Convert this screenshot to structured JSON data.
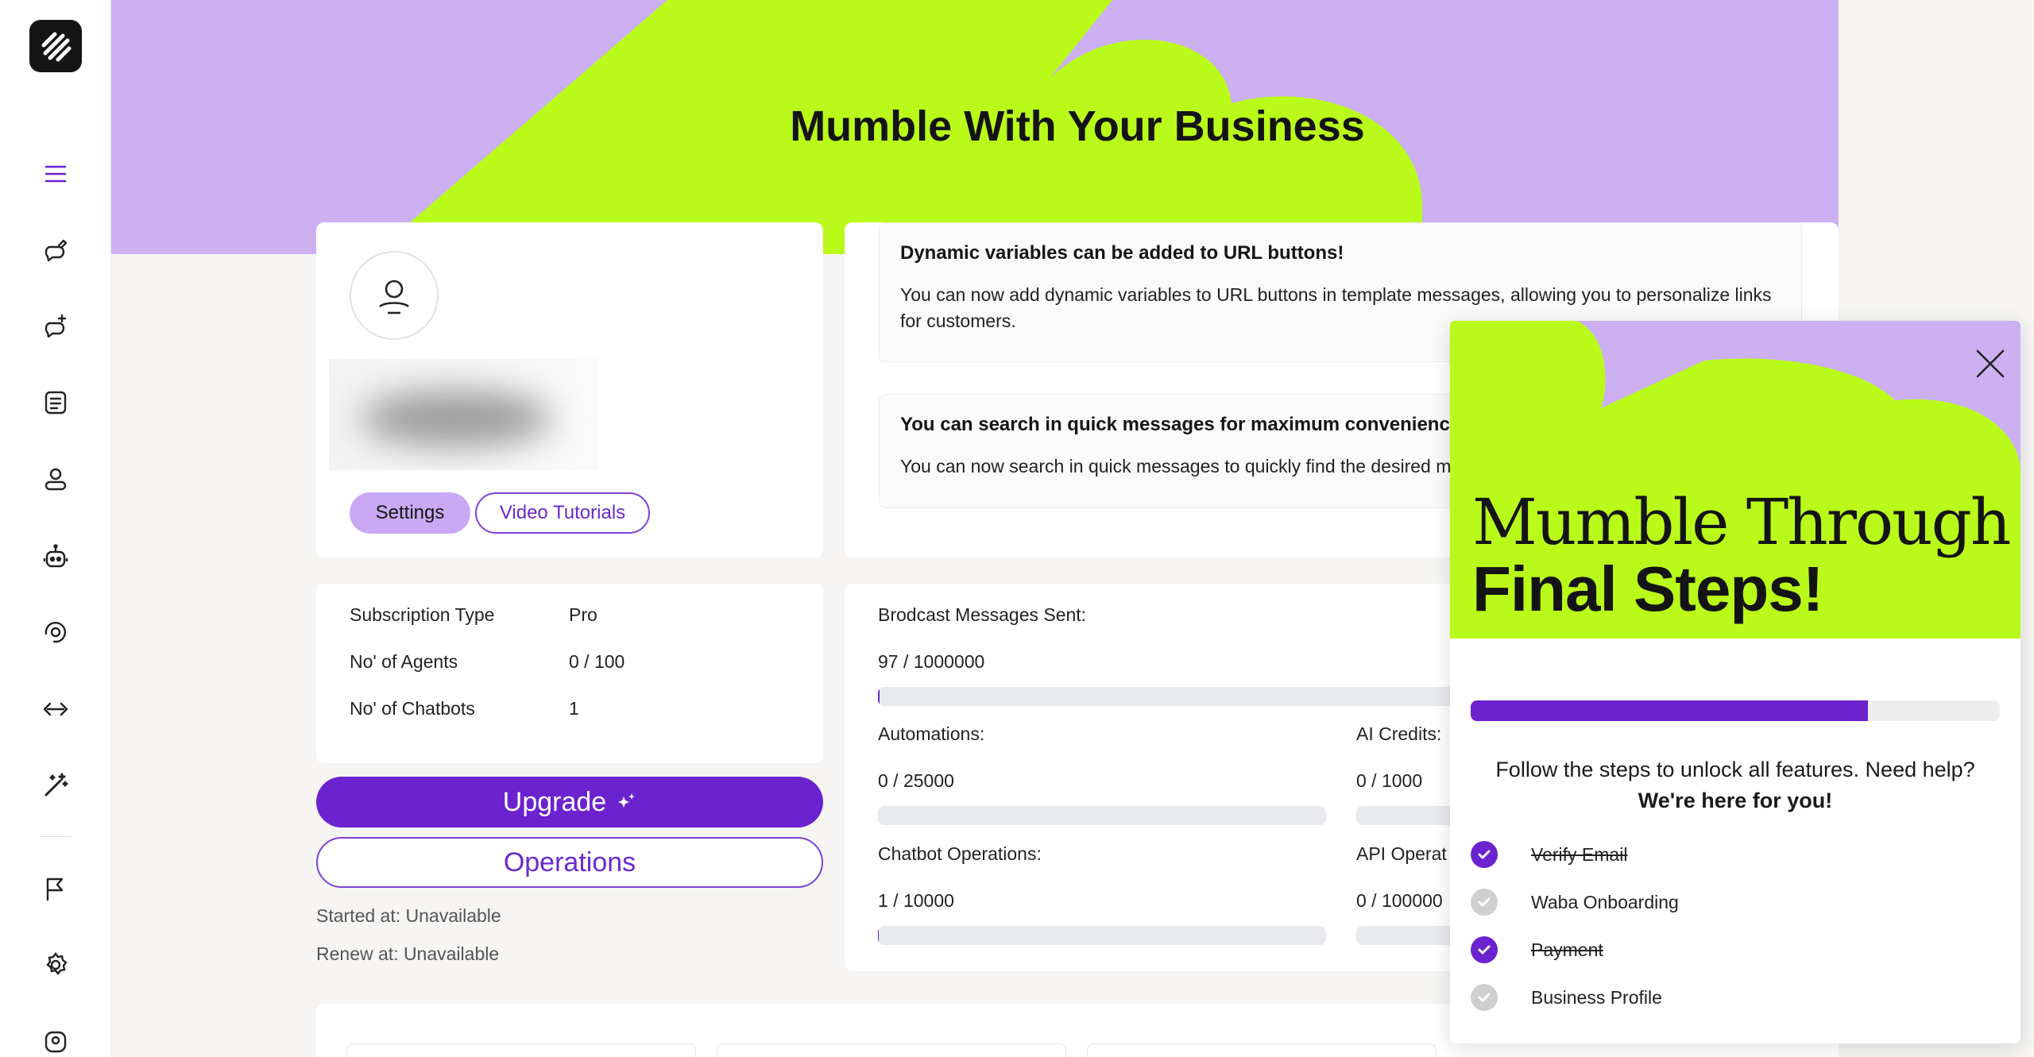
{
  "hero": {
    "title": "Mumble With Your Business"
  },
  "sidebar": {
    "items": [
      {
        "icon": "menu-icon"
      },
      {
        "icon": "chat-edit-icon"
      },
      {
        "icon": "chat-add-icon"
      },
      {
        "icon": "template-icon"
      },
      {
        "icon": "user-icon"
      },
      {
        "icon": "bot-icon"
      },
      {
        "icon": "support-icon"
      },
      {
        "icon": "api-icon"
      },
      {
        "icon": "magic-wand-icon"
      },
      {
        "icon": "flag-icon"
      },
      {
        "icon": "gear-icon"
      }
    ]
  },
  "profile": {
    "settings_label": "Settings",
    "video_label": "Video Tutorials"
  },
  "announcements": [
    {
      "title": "Dynamic variables can be added to URL buttons!",
      "body": "You can now add dynamic variables to URL buttons in template messages, allowing you to personalize links for customers."
    },
    {
      "title": "You can search in quick messages for maximum convenience!",
      "body": "You can now search in quick messages to quickly find the desired m"
    }
  ],
  "subscription": {
    "rows": [
      {
        "label": "Subscription Type",
        "value": "Pro"
      },
      {
        "label": "No' of Agents",
        "value": "0 / 100"
      },
      {
        "label": "No' of Chatbots",
        "value": "1"
      }
    ]
  },
  "actions": {
    "upgrade_label": "Upgrade",
    "operations_label": "Operations",
    "started": "Started at: Unavailable",
    "renew": "Renew at: Unavailable"
  },
  "usage": {
    "broadcast": {
      "label": "Brodcast Messages Sent:",
      "value": "97 / 1000000",
      "fraction": 0.0001
    },
    "automations": {
      "label": "Automations:",
      "value": "0 / 25000",
      "fraction": 0
    },
    "ai_credits": {
      "label": "AI Credits:",
      "value": "0 / 1000",
      "fraction": 0
    },
    "chatbot_ops": {
      "label": "Chatbot Operations:",
      "value": "1 / 10000",
      "fraction": 0.0001
    },
    "api_ops": {
      "label": "API Operat",
      "value": "0 / 100000",
      "fraction": 0
    }
  },
  "popup": {
    "title_line1": "Mumble Through",
    "title_line2": "Final Steps!",
    "progress": 0.75,
    "help_text": "Follow the steps to unlock all features. Need help?",
    "help_bold": "We're here for you!",
    "steps": [
      {
        "label": "Verify Email",
        "done": true
      },
      {
        "label": "Waba Onboarding",
        "done": false
      },
      {
        "label": "Payment",
        "done": true
      },
      {
        "label": "Business Profile",
        "done": false
      }
    ]
  },
  "colors": {
    "accent": "#6b22cf",
    "lavender": "#ccb0f2",
    "lime": "#bafa1a"
  }
}
